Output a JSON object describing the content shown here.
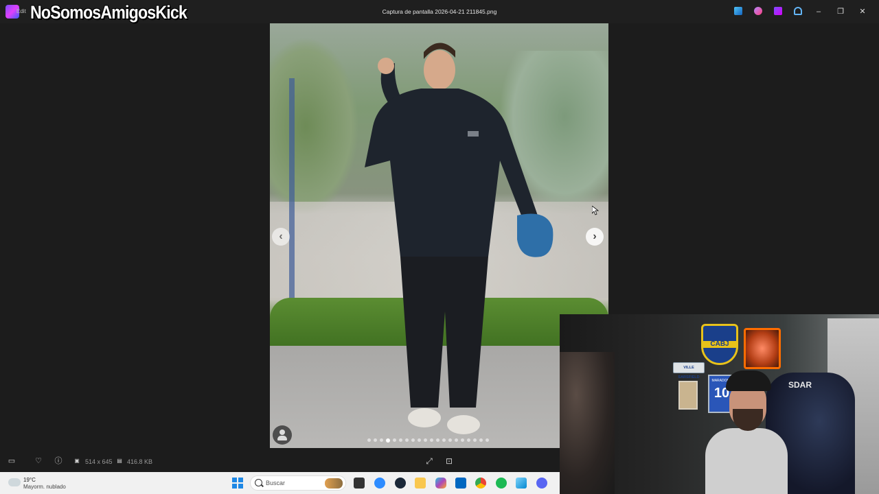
{
  "overlay": {
    "stream_title": "NoSomosAmigosKick"
  },
  "window": {
    "title": "Captura de pantalla 2026-04-21 211845.png",
    "app_label": "Edit",
    "controls": {
      "minimize": "–",
      "maximize": "❐",
      "close": "✕"
    }
  },
  "viewer": {
    "prev_label": "‹",
    "next_label": "›",
    "image_dimensions": "514 x 645",
    "file_size": "416.8 KB",
    "dot_count": 20,
    "active_dot_index": 3
  },
  "taskbar": {
    "weather_temp": "19°C",
    "weather_desc": "Mayorm. nublado",
    "search_placeholder": "Buscar",
    "apps": [
      "file-manager-icon",
      "zoom-icon",
      "steam-icon",
      "folder-icon",
      "copilot-icon",
      "store-icon",
      "chrome-icon",
      "spotify-icon",
      "photos-icon",
      "discord-icon"
    ]
  },
  "webcam": {
    "shield_text": "CABJ",
    "plate_text": "VILLE SARSFIELD",
    "jersey_label": "MARADONA",
    "jersey_number": "10",
    "chair_text": "SDAR"
  },
  "colors": {
    "taskbar_bg": "#f1f1f1",
    "viewer_bg": "#1c1c1c",
    "boca_blue": "#1a3f8a",
    "boca_yellow": "#e8c21a"
  }
}
